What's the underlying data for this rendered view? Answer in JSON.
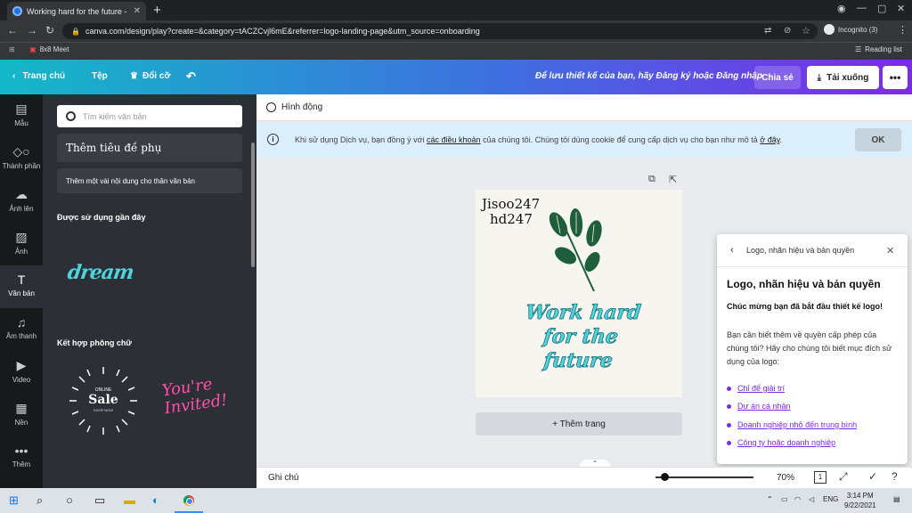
{
  "browser": {
    "tab_title": "Working hard for the future - Logo",
    "url": "canva.com/design/play?create=&category=tACZCvjl6mE&referrer=logo-landing-page&utm_source=onboarding",
    "profile": "Incognito (3)",
    "bookmark": "8x8 Meet",
    "reading_list": "Reading list"
  },
  "header": {
    "home": "Trang chủ",
    "file": "Tệp",
    "resize": "Đổi cỡ",
    "save_prompt": "Để lưu thiết kế của bạn, hãy Đăng ký hoặc Đăng nhập",
    "share": "Chia sẻ",
    "download": "Tải xuống",
    "more": "•••"
  },
  "rail": [
    {
      "label": "Mẫu",
      "icon": "template-icon"
    },
    {
      "label": "Thành phần",
      "icon": "elements-icon"
    },
    {
      "label": "Ảnh lên",
      "icon": "upload-icon"
    },
    {
      "label": "Ảnh",
      "icon": "photo-icon"
    },
    {
      "label": "Văn bản",
      "icon": "text-icon"
    },
    {
      "label": "Âm thanh",
      "icon": "music-icon"
    },
    {
      "label": "Video",
      "icon": "video-icon"
    },
    {
      "label": "Nền",
      "icon": "background-icon"
    },
    {
      "label": "Thêm",
      "icon": "more-icon"
    }
  ],
  "panel": {
    "search_placeholder": "Tìm kiếm văn bản",
    "subheading": "Thêm tiêu đề phụ",
    "body_text": "Thêm một vài nội dung cho thân văn bản",
    "recent_title": "Được sử dụng gần đây",
    "recent_sample": "dream",
    "combos_title": "Kết hợp phông chữ",
    "combo_sale_top": "ONLINE",
    "combo_sale": "Sale",
    "combo_sale_sub": "SHOP NOW",
    "combo_invited": "You're Invited!"
  },
  "workspace": {
    "animate": "Hình động",
    "cookie_pre": "Khi sử dụng Dịch vụ, bạn đồng ý với ",
    "cookie_link": "các điều khoản",
    "cookie_mid": " của chúng tôi. Chúng tôi dùng cookie để cung cấp dịch vụ cho bạn như mô tả ",
    "cookie_link2": "ở đây",
    "cookie_end": ".",
    "ok": "OK",
    "canvas_line1": "Jisoo247",
    "canvas_line2": "hd247",
    "canvas_slogan_1": "Work hard",
    "canvas_slogan_2": "for the",
    "canvas_slogan_3": "future",
    "add_page": "+ Thêm trang",
    "notes": "Ghi chú",
    "zoom": "70%",
    "page_count": "1"
  },
  "dialog": {
    "bar_title": "Logo, nhãn hiệu và bản quyền",
    "heading": "Logo, nhãn hiệu và bản quyền",
    "congrats": "Chúc mừng bạn đã bắt đầu thiết kế logo!",
    "question": "Bạn cần biết thêm về quyền cấp phép của chúng tôi? Hãy cho chúng tôi biết mục đích sử dụng của logo:",
    "options": [
      "Chỉ để giải trí",
      "Dự án cá nhân",
      "Doanh nghiệp nhỏ đến trung bình",
      "Công ty hoặc doanh nghiệp"
    ]
  },
  "taskbar": {
    "lang": "ENG",
    "time": "3:14 PM",
    "date": "9/22/2021"
  },
  "colors": {
    "accent_purple": "#7d2ae8",
    "accent_teal": "#13b8c6",
    "leaf_green": "#1f5e3a",
    "text_teal": "#4fd3dc"
  }
}
